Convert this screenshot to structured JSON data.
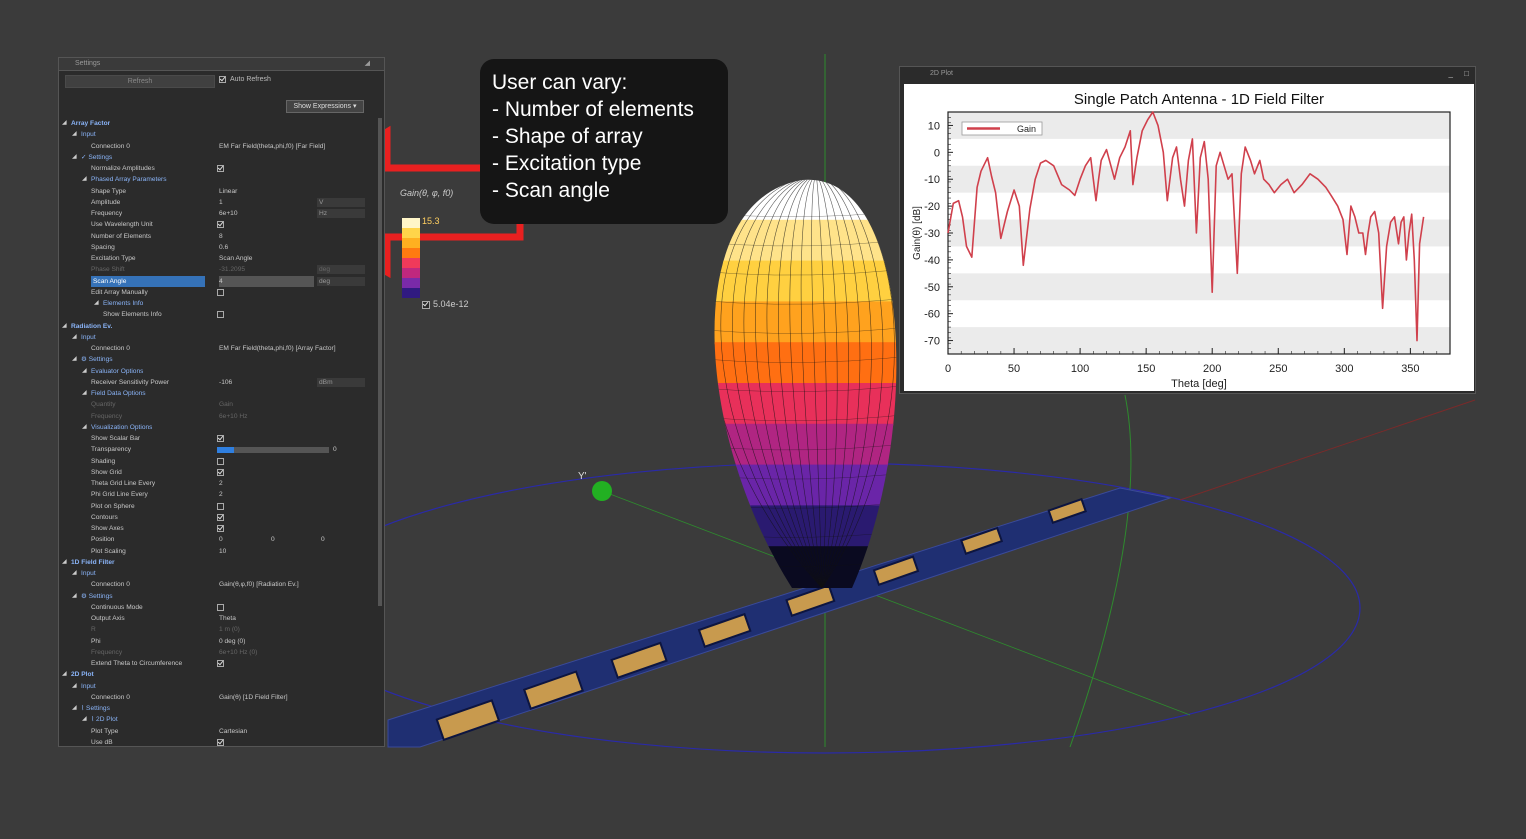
{
  "settings": {
    "title": "Settings",
    "refresh_label": "Refresh",
    "auto_refresh_label": "Auto Refresh",
    "show_expressions_label": "Show Expressions ▾",
    "rows": [
      {
        "level": 0,
        "tri": "◢",
        "label": "Array Factor",
        "style": "sec"
      },
      {
        "level": 1,
        "tri": "◢",
        "label": "Input",
        "style": "sub"
      },
      {
        "level": 2,
        "label": "Connection 0",
        "value": "EM Far Field(theta,phi,f0) [Far Field]"
      },
      {
        "level": 1,
        "tri": "◢",
        "label": "✓ Settings",
        "style": "sub"
      },
      {
        "level": 2,
        "label": "Normalize Amplitudes",
        "check": true
      },
      {
        "level": 2,
        "tri": "◢",
        "label": "Phased Array Parameters",
        "style": "sub"
      },
      {
        "level": 2,
        "label": "Shape Type",
        "value": "Linear"
      },
      {
        "level": 2,
        "label": "Amplitude",
        "value": "1",
        "unit": "V"
      },
      {
        "level": 2,
        "label": "Frequency",
        "value": "6e+10",
        "unit": "Hz"
      },
      {
        "level": 2,
        "label": "Use Wavelength Unit",
        "check": true
      },
      {
        "level": 2,
        "label": "Number of Elements",
        "value": "8"
      },
      {
        "level": 2,
        "label": "Spacing",
        "value": "0.6"
      },
      {
        "level": 2,
        "label": "Excitation Type",
        "value": "Scan Angle"
      },
      {
        "level": 2,
        "label": "Phase Shift",
        "value": "-31.2095",
        "unit": "deg",
        "dim": true
      },
      {
        "level": 2,
        "label": "Scan Angle",
        "value": "4",
        "unit": "deg",
        "sel": true
      },
      {
        "level": 2,
        "label": "Edit Array Manually",
        "check": false
      },
      {
        "level": 3,
        "tri": "◢",
        "label": "Elements Info",
        "style": "sub"
      },
      {
        "level": 3,
        "label": "Show Elements Info",
        "check": false
      },
      {
        "level": 0,
        "tri": "◢",
        "label": "Radiation Ev.",
        "style": "sec"
      },
      {
        "level": 1,
        "tri": "◢",
        "label": "Input",
        "style": "sub"
      },
      {
        "level": 2,
        "label": "Connection 0",
        "value": "EM Far Field(theta,phi,f0) [Array Factor]"
      },
      {
        "level": 1,
        "tri": "◢",
        "label": "⚙ Settings",
        "style": "sub"
      },
      {
        "level": 2,
        "tri": "◢",
        "label": "Evaluator Options",
        "style": "sub"
      },
      {
        "level": 2,
        "label": "Receiver Sensitivity Power",
        "value": "-106",
        "unit": "dBm"
      },
      {
        "level": 2,
        "tri": "◢",
        "label": "Field Data Options",
        "style": "sub"
      },
      {
        "level": 2,
        "label": "Quantity",
        "value": "Gain",
        "dim": true
      },
      {
        "level": 2,
        "label": "Frequency",
        "value": "6e+10 Hz",
        "dim": true
      },
      {
        "level": 2,
        "tri": "◢",
        "label": "Visualization Options",
        "style": "sub"
      },
      {
        "level": 2,
        "label": "Show Scalar Bar",
        "check": true
      },
      {
        "level": 2,
        "label": "Transparency",
        "bar": 0.15,
        "barval": "0"
      },
      {
        "level": 2,
        "label": "Shading",
        "check": false
      },
      {
        "level": 2,
        "label": "Show Grid",
        "check": true
      },
      {
        "level": 2,
        "label": "Theta Grid Line Every",
        "value": "2"
      },
      {
        "level": 2,
        "label": "Phi Grid Line Every",
        "value": "2"
      },
      {
        "level": 2,
        "label": "Plot on Sphere",
        "check": false
      },
      {
        "level": 2,
        "label": "Contours",
        "check": true
      },
      {
        "level": 2,
        "label": "Show Axes",
        "check": true
      },
      {
        "level": 2,
        "label": "Position",
        "value": "0",
        "value2": "0",
        "value3": "0"
      },
      {
        "level": 2,
        "label": "Plot Scaling",
        "value": "10"
      },
      {
        "level": 0,
        "tri": "◢",
        "label": "1D Field Filter",
        "style": "sec"
      },
      {
        "level": 1,
        "tri": "◢",
        "label": "Input",
        "style": "sub"
      },
      {
        "level": 2,
        "label": "Connection 0",
        "value": "Gain(θ,φ,f0) [Radiation Ev.]"
      },
      {
        "level": 1,
        "tri": "◢",
        "label": "⚙ Settings",
        "style": "sub"
      },
      {
        "level": 2,
        "label": "Continuous Mode",
        "check": false
      },
      {
        "level": 2,
        "label": "Output Axis",
        "value": "Theta"
      },
      {
        "level": 2,
        "label": "R",
        "value": "1 m (0)",
        "dim": true
      },
      {
        "level": 2,
        "label": "Phi",
        "value": "0 deg (0)"
      },
      {
        "level": 2,
        "label": "Frequency",
        "value": "6e+10 Hz (0)",
        "dim": true
      },
      {
        "level": 2,
        "label": "Extend Theta to Circumference",
        "check": true
      },
      {
        "level": 0,
        "tri": "◢",
        "label": "2D Plot",
        "style": "sec"
      },
      {
        "level": 1,
        "tri": "◢",
        "label": "Input",
        "style": "sub"
      },
      {
        "level": 2,
        "label": "Connection 0",
        "value": "Gain(θ) [1D Field Filter]"
      },
      {
        "level": 1,
        "tri": "◢",
        "label": "⌇ Settings",
        "style": "sub"
      },
      {
        "level": 2,
        "tri": "◢",
        "label": "⌇ 2D Plot",
        "style": "sub"
      },
      {
        "level": 2,
        "label": "Plot Type",
        "value": "Cartesian"
      },
      {
        "level": 2,
        "label": "Use dB",
        "check": true
      }
    ]
  },
  "callout": {
    "lines": [
      "User can vary:",
      "- Number of elements",
      "- Shape of array",
      "- Excitation type",
      "- Scan angle"
    ]
  },
  "colorscale": {
    "title": "Gain(θ, φ, f0)",
    "max": "15.3",
    "min": "5.04e-12",
    "colors": [
      "#fff6c8",
      "#ffd54a",
      "#ffb020",
      "#ff7a10",
      "#f03a5a",
      "#c0287e",
      "#7a2aa8",
      "#301a80"
    ]
  },
  "scene": {
    "y_axis_label": "Y'",
    "background": "#3b3b3b",
    "array_base_color": "#1f2f72",
    "patch_color": "#c89a4e",
    "lobe_colors": [
      "#ffffff",
      "#ffe38a",
      "#ffd040",
      "#ffa21e",
      "#ff6f12",
      "#e8305a",
      "#b02582",
      "#6a25a8",
      "#2a1a70",
      "#0a0a20"
    ]
  },
  "plot_window": {
    "title": "2D Plot",
    "minimize": "_",
    "maximize": "□"
  },
  "chart_data": {
    "type": "line",
    "title": "Single Patch Antenna - 1D Field Filter",
    "xlabel": "Theta [deg]",
    "ylabel": "Gain(θ) [dB]",
    "xlim": [
      0,
      380
    ],
    "ylim": [
      -75,
      15
    ],
    "xticks": [
      0,
      50,
      100,
      150,
      200,
      250,
      300,
      350
    ],
    "yticks": [
      10,
      0,
      -10,
      -20,
      -30,
      -40,
      -50,
      -60,
      -70
    ],
    "grid": "horizontal bands",
    "legend": "top-left",
    "series": [
      {
        "name": "Gain",
        "color": "#d0404c",
        "x": [
          0,
          4,
          8,
          11,
          14,
          18,
          22,
          25,
          30,
          33,
          36,
          40,
          45,
          50,
          54,
          57,
          62,
          66,
          70,
          74,
          80,
          86,
          92,
          96,
          100,
          104,
          108,
          110,
          112,
          114,
          116,
          120,
          126,
          130,
          134,
          138,
          140,
          143,
          147,
          151,
          155,
          159,
          163,
          166,
          170,
          173,
          176,
          179,
          182,
          185,
          188,
          191,
          194,
          197,
          200,
          203,
          206,
          209,
          212,
          215,
          219,
          222,
          225,
          229,
          232,
          236,
          239,
          243,
          247,
          252,
          257,
          262,
          268,
          274,
          280,
          286,
          290,
          295,
          299,
          302,
          305,
          308,
          311,
          314,
          316,
          318,
          320,
          323,
          326,
          329,
          332,
          335,
          338,
          341,
          343,
          345,
          347,
          349,
          351,
          353,
          355,
          357,
          360,
          363,
          365,
          367,
          369,
          370,
          364,
          362
        ],
        "y": [
          -30,
          -19,
          -18,
          -24,
          -35,
          -39,
          -13,
          -7,
          -2,
          -9,
          -15,
          -32,
          -22,
          -14,
          -20,
          -42,
          -21,
          -10,
          -4,
          -3,
          -5,
          -12,
          -14,
          -16,
          -10,
          -5,
          -2,
          -10,
          -18,
          -10,
          -3,
          1,
          -10,
          -2,
          2,
          8,
          -12,
          -2,
          8,
          12,
          15,
          10,
          0,
          -18,
          -2,
          2,
          -10,
          -20,
          -3,
          5,
          -30,
          -2,
          4,
          -10,
          -52,
          -5,
          0,
          -5,
          -10,
          -8,
          -45,
          -8,
          2,
          -3,
          -8,
          -3,
          -10,
          -12,
          -15,
          -12,
          -10,
          -15,
          -12,
          -8,
          -10,
          -13,
          -16,
          -20,
          -25,
          -38,
          -20,
          -24,
          -30,
          -30,
          -38,
          -30,
          -24,
          -22,
          -30,
          -58,
          -35,
          -26,
          -24,
          -34,
          -26,
          -24,
          -40,
          -30,
          -23,
          -40,
          -70,
          -34,
          -24,
          -20,
          -25,
          -38,
          -40,
          -45,
          -22,
          -20
        ],
        "shown_x_max": 360
      }
    ]
  }
}
